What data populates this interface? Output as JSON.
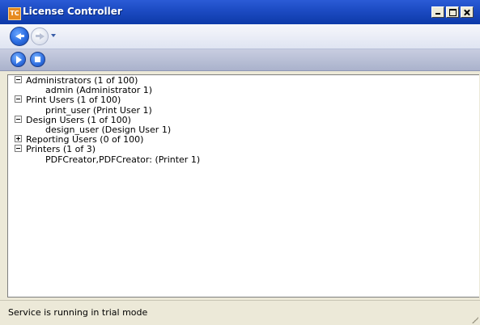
{
  "window": {
    "title": "License Controller",
    "icon_text": "TC"
  },
  "navigation": {
    "back_icon": "arrow-left-icon",
    "forward_icon": "arrow-right-icon",
    "history_icon": "chevron-down-icon"
  },
  "toolbar": {
    "start_icon": "play-icon",
    "stop_icon": "stop-icon"
  },
  "tree": {
    "groups": [
      {
        "label": "Administrators (1 of 100)",
        "expanded": true,
        "children": [
          "admin (Administrator 1)"
        ]
      },
      {
        "label": "Print Users (1 of 100)",
        "expanded": true,
        "children": [
          "print_user (Print User 1)"
        ]
      },
      {
        "label": "Design Users (1 of 100)",
        "expanded": true,
        "children": [
          "design_user (Design User 1)"
        ]
      },
      {
        "label": "Reporting Users (0 of 100)",
        "expanded": false,
        "children": []
      },
      {
        "label": "Printers (1 of 3)",
        "expanded": true,
        "children": [
          "PDFCreator,PDFCreator: (Printer 1)"
        ]
      }
    ]
  },
  "status": {
    "text": "Service is running in trial mode"
  },
  "colors": {
    "title_bar": "#1d4cc4",
    "accent_blue": "#2a6be0",
    "chrome": "#ece9d8"
  }
}
